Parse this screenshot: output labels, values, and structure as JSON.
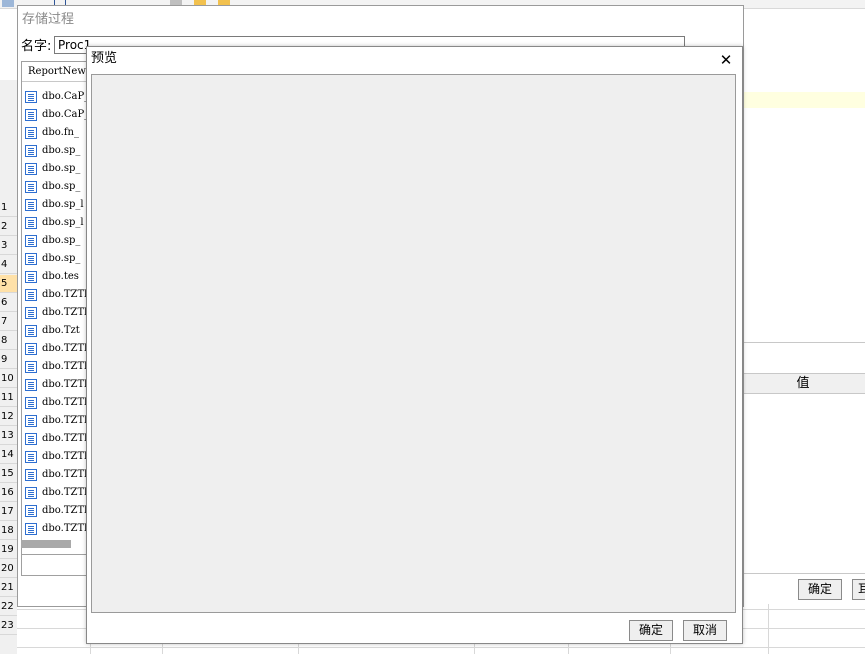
{
  "background": {
    "row_numbers": [
      "1",
      "2",
      "3",
      "4",
      "5",
      "6",
      "7",
      "8",
      "9",
      "10",
      "11",
      "12",
      "13",
      "14",
      "15",
      "16",
      "17",
      "18",
      "19",
      "20",
      "21",
      "22",
      "23"
    ],
    "selected_row": "5",
    "value_column_header": "值",
    "confirm_label": "确定",
    "cancel_stub_label": "耳"
  },
  "sp_dialog": {
    "title": "存储过程",
    "name_label": "名字:",
    "name_value": "Proc1",
    "list_header": "ReportNew",
    "procedures": [
      "dbo.CaP_",
      "dbo.CaP_",
      "dbo.fn_",
      "dbo.sp_",
      "dbo.sp_",
      "dbo.sp_",
      "dbo.sp_l",
      "dbo.sp_l",
      "dbo.sp_",
      "dbo.sp_",
      "dbo.tes",
      "dbo.TZTl",
      "dbo.TZTl",
      "dbo.Tzt",
      "dbo.TZTl",
      "dbo.TZTl",
      "dbo.TZTl",
      "dbo.TZTl",
      "dbo.TZTl",
      "dbo.TZTl",
      "dbo.TZTl",
      "dbo.TZTl",
      "dbo.TZTl",
      "dbo.TZTl",
      "dbo.TZTl"
    ]
  },
  "preview": {
    "title": "预览",
    "close_glyph": "✕",
    "ok_label": "确定",
    "cancel_label": "取消"
  },
  "colors": {
    "selected_row": "#ffe1a8",
    "highlight_row": "#ffffe0",
    "preview_canvas": "#efefef",
    "proc_icon": "#2f6fd0"
  }
}
